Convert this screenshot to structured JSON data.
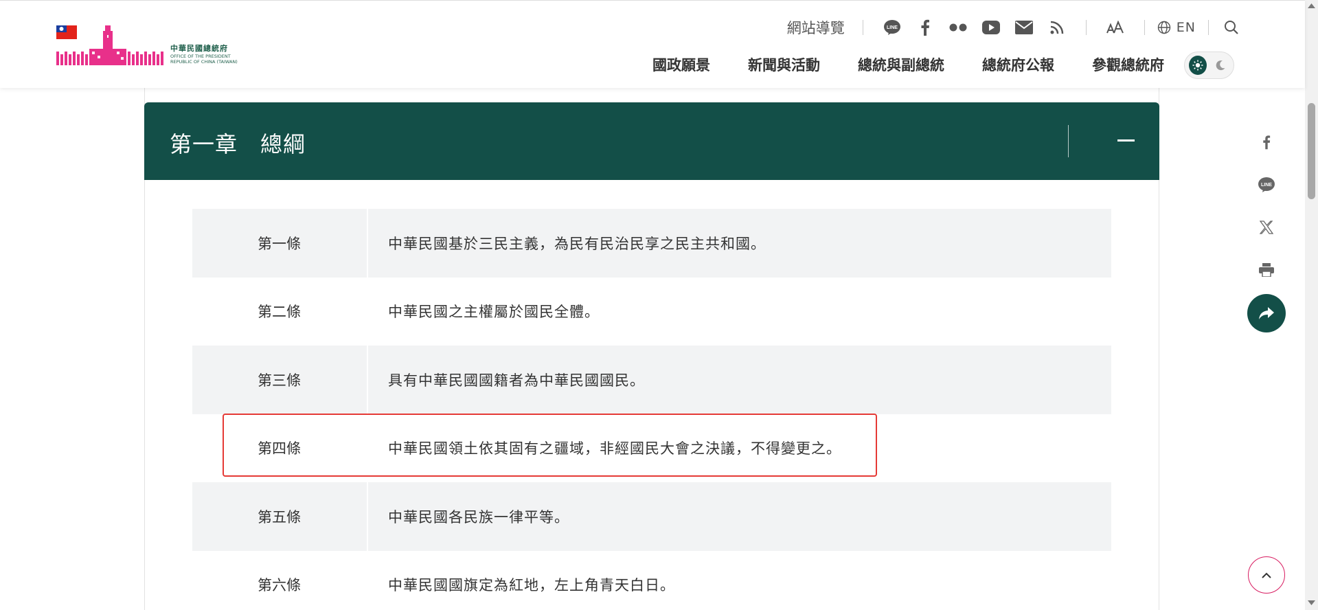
{
  "header": {
    "logo_zh": "中華民國總統府",
    "logo_en_1": "OFFICE OF THE PRESIDENT",
    "logo_en_2": "REPUBLIC OF CHINA (TAIWAN)",
    "sitemap": "網站導覽",
    "social_icons": [
      "line-icon",
      "facebook-icon",
      "flickr-icon",
      "youtube-icon",
      "mail-icon",
      "rss-icon"
    ],
    "font_size_icon": "font-size-icon",
    "language": "EN",
    "nav": [
      "國政願景",
      "新聞與活動",
      "總統與副總統",
      "總統府公報",
      "參觀總統府"
    ]
  },
  "chapter": {
    "title": "第一章　總綱"
  },
  "articles": [
    {
      "num": "第一條",
      "text": "中華民國基於三民主義，為民有民治民享之民主共和國。"
    },
    {
      "num": "第二條",
      "text": "中華民國之主權屬於國民全體。"
    },
    {
      "num": "第三條",
      "text": "具有中華民國國籍者為中華民國國民。"
    },
    {
      "num": "第四條",
      "text": "中華民國領土依其固有之疆域，非經國民大會之決議，不得變更之。"
    },
    {
      "num": "第五條",
      "text": "中華民國各民族一律平等。"
    },
    {
      "num": "第六條",
      "text": "中華民國國旗定為紅地，左上角青天白日。"
    }
  ],
  "share_icons": [
    "facebook-icon",
    "line-icon",
    "x-icon",
    "print-icon",
    "share-icon"
  ],
  "colors": {
    "brand_green": "#134f48",
    "brand_pink": "#e8308a",
    "highlight_red": "#e53935"
  }
}
